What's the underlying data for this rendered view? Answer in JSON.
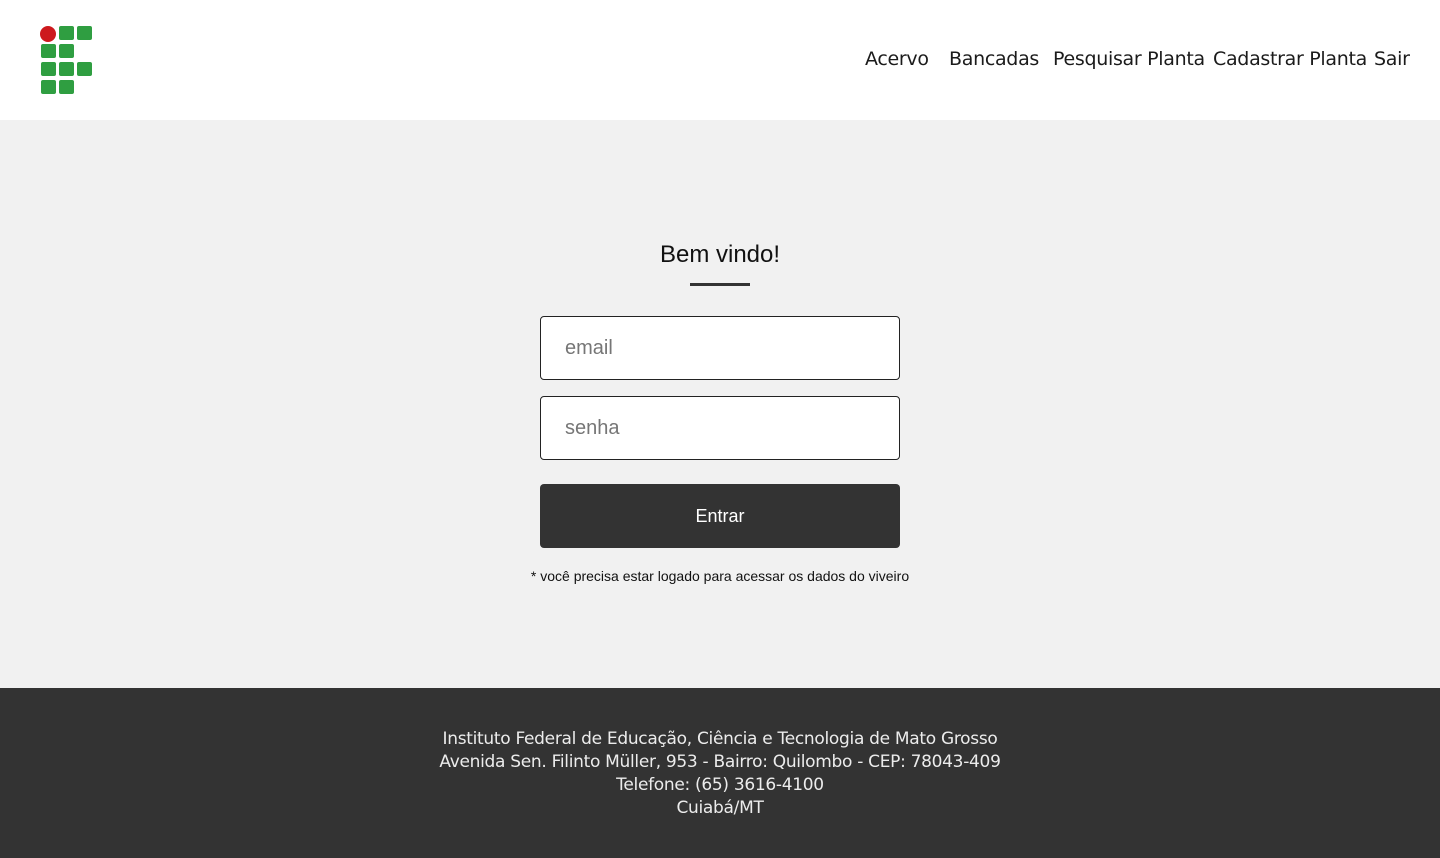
{
  "header": {
    "logo_colors": {
      "green": "#2f9e41",
      "red": "#cd191e"
    },
    "nav": [
      "Acervo",
      "Bancadas",
      "Pesquisar Planta",
      "Cadastrar Planta",
      "Sair"
    ]
  },
  "login": {
    "title": "Bem vindo!",
    "email_placeholder": "email",
    "email_value": "",
    "password_placeholder": "senha",
    "password_value": "",
    "submit_label": "Entrar",
    "note": "* você precisa estar logado para acessar os dados do viveiro"
  },
  "footer": {
    "lines": [
      "Instituto Federal de Educação, Ciência e Tecnologia de Mato Grosso",
      "Avenida Sen. Filinto Müller, 953 - Bairro: Quilombo - CEP: 78043-409",
      "Telefone: (65) 3616-4100",
      "Cuiabá/MT"
    ]
  }
}
